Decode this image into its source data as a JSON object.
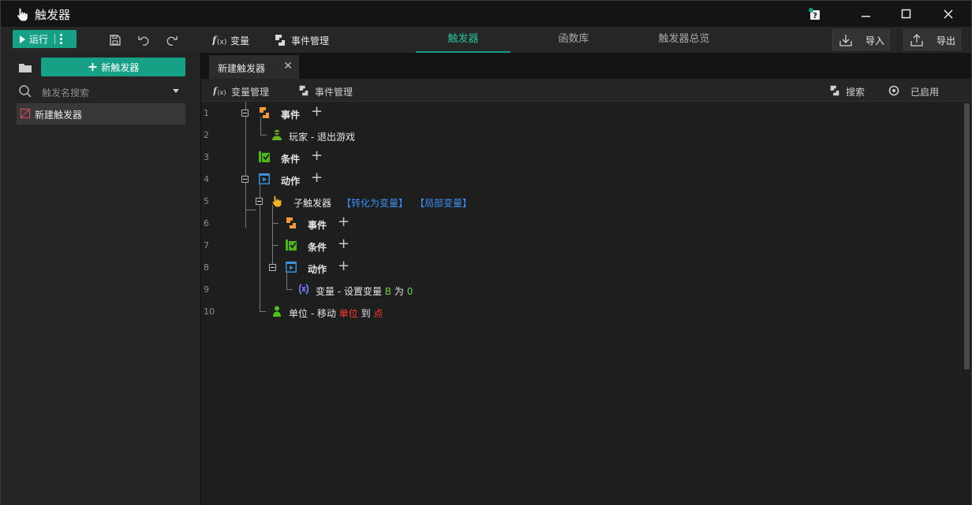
{
  "window": {
    "title": "触发器"
  },
  "toolbar": {
    "run_label": "运行",
    "variable_label": "变量",
    "event_mgmt_label": "事件管理",
    "tabs": [
      {
        "label": "触发器",
        "active": true
      },
      {
        "label": "函数库",
        "active": false
      },
      {
        "label": "触发器总览",
        "active": false
      }
    ],
    "import_label": "导入",
    "export_label": "导出"
  },
  "sidebar": {
    "new_trigger_label": "新触发器",
    "search_placeholder": "触发名搜索",
    "items": [
      {
        "label": "新建触发器"
      }
    ]
  },
  "editor": {
    "doc_tab_label": "新建触发器",
    "subbar": {
      "variable_mgmt_label": "变量管理",
      "event_mgmt_label": "事件管理",
      "search_label": "搜索",
      "enabled_label": "已启用"
    },
    "line_numbers": [
      "1",
      "2",
      "3",
      "4",
      "5",
      "6",
      "7",
      "8",
      "9",
      "10"
    ],
    "lines": {
      "event1": "事件",
      "player_exit": "玩家 - 退出游戏",
      "condition1": "条件",
      "action1": "动作",
      "sub_trigger": "子触发器",
      "convert_link": "【转化为变量】",
      "local_var_link": "【局部变量】",
      "event2": "事件",
      "condition2": "条件",
      "action2": "动作",
      "set_var_prefix": "变量 - 设置变量",
      "set_var_name": "B",
      "set_var_mid": "为",
      "set_var_value": "0",
      "move_prefix": "单位 - 移动",
      "move_unit": "单位",
      "move_mid": "到",
      "move_point": "点"
    }
  },
  "colors": {
    "accent": "#16a085",
    "link": "#3d8df5",
    "param_red": "#ff3b30",
    "param_green": "#6ad04a",
    "event_icon": "#f39a3c",
    "condition_icon": "#4fb51f",
    "action_icon": "#3e8fd8"
  }
}
